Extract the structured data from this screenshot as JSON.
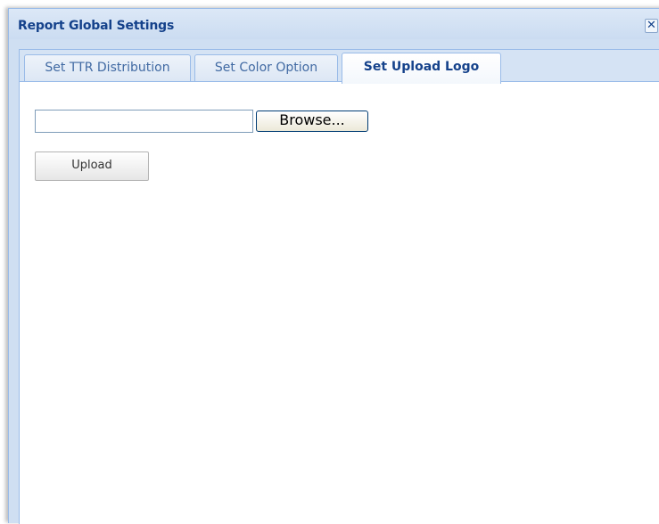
{
  "dialog": {
    "title": "Report Global Settings",
    "close_glyph": "✕"
  },
  "tabs": [
    {
      "label": "Set TTR Distribution",
      "active": false
    },
    {
      "label": "Set Color Option",
      "active": false
    },
    {
      "label": "Set Upload Logo",
      "active": true
    }
  ],
  "upload_panel": {
    "file_value": "",
    "browse_label": "Browse...",
    "upload_label": "Upload"
  },
  "colors": {
    "title_text": "#15428b",
    "frame_border": "#99bbe8",
    "header_bg": "#cfdff2"
  },
  "icons": {
    "close": "close-icon"
  }
}
